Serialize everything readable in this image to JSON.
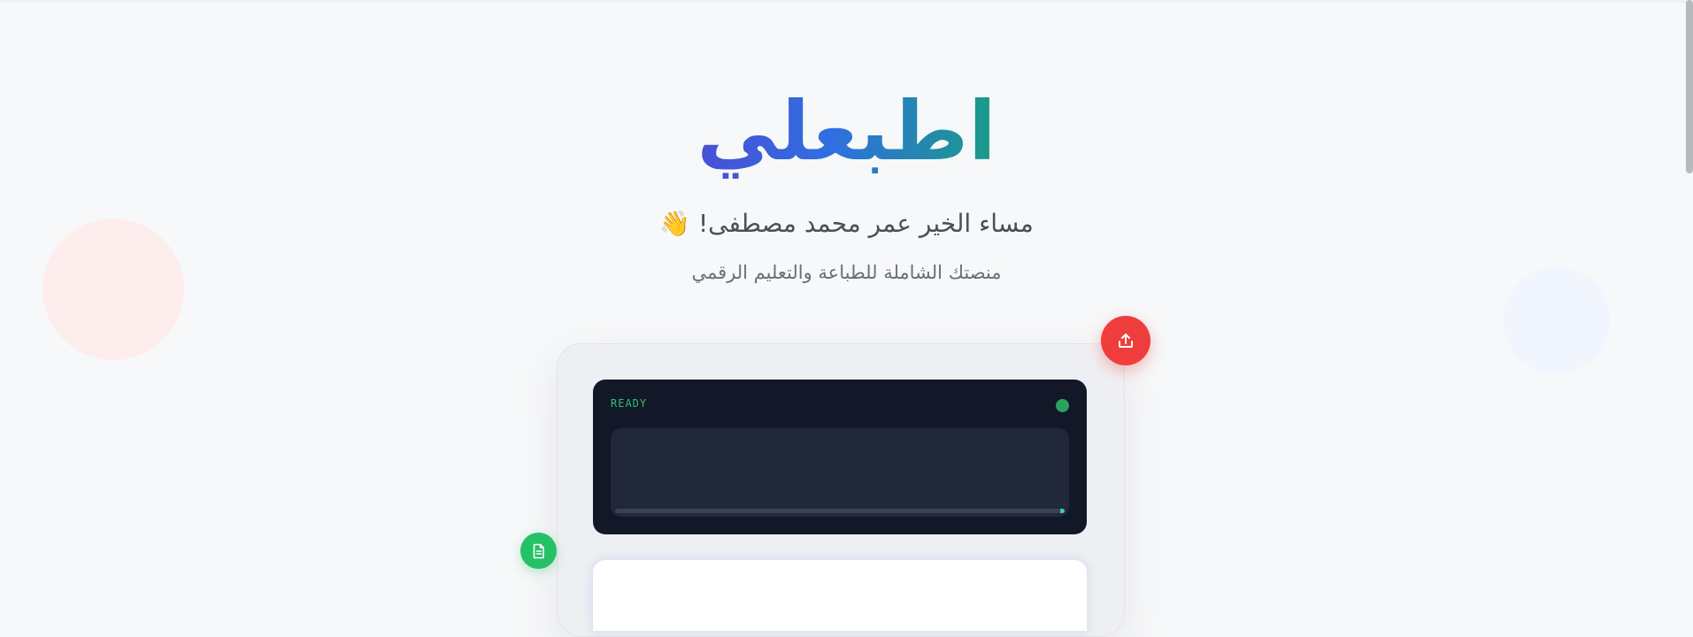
{
  "brand": {
    "name": "اطبعلي"
  },
  "header": {
    "greeting": "مساء الخير عمر محمد مصطفى! 👋",
    "tagline": "منصتك الشاملة للطباعة والتعليم الرقمي"
  },
  "printer": {
    "status_label": "READY",
    "status_color": "#27a35f",
    "progress": 0.01
  },
  "actions": {
    "upload_icon": "upload-icon",
    "file_icon": "document-icon"
  },
  "colors": {
    "accent_red": "#ef3d3d",
    "accent_green": "#24c165",
    "screen_bg": "#121827"
  }
}
